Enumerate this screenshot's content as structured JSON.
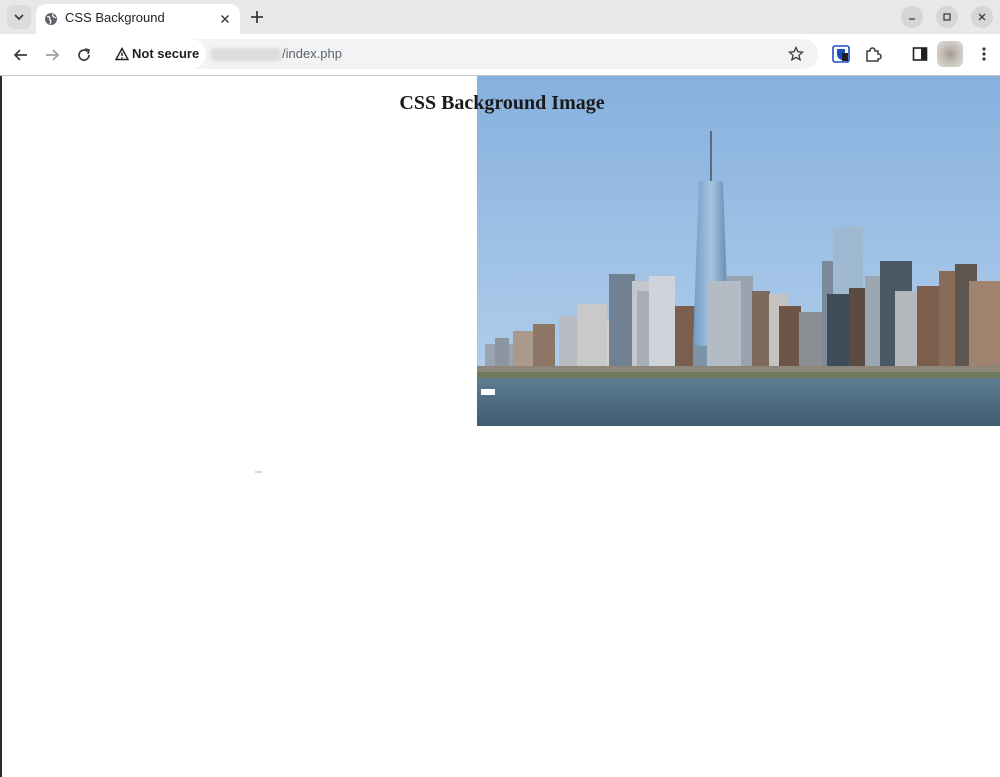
{
  "browser": {
    "tab": {
      "title": "CSS Background"
    },
    "address_bar": {
      "security_label": "Not secure",
      "url_path": "/index.php"
    },
    "icons": {
      "tab_search": "chevron-down-icon",
      "favicon": "globe-icon",
      "tab_close": "close-icon",
      "new_tab": "plus-icon",
      "minimize": "minimize-icon",
      "maximize": "maximize-icon",
      "close_window": "close-icon",
      "back": "back-arrow-icon",
      "forward": "forward-arrow-icon",
      "reload": "reload-icon",
      "security": "warning-triangle-icon",
      "bookmark": "star-icon",
      "extension_1": "bitwarden-icon",
      "extensions": "puzzle-icon",
      "side_panel": "side-panel-icon",
      "profile": "avatar",
      "menu": "kebab-menu-icon"
    }
  },
  "page": {
    "heading": "CSS Background Image",
    "background_image": "city-skyline-photo"
  },
  "colors": {
    "sky": "#8fb8e0",
    "water": "#4f6d82",
    "heading": "#1a1a1a"
  }
}
